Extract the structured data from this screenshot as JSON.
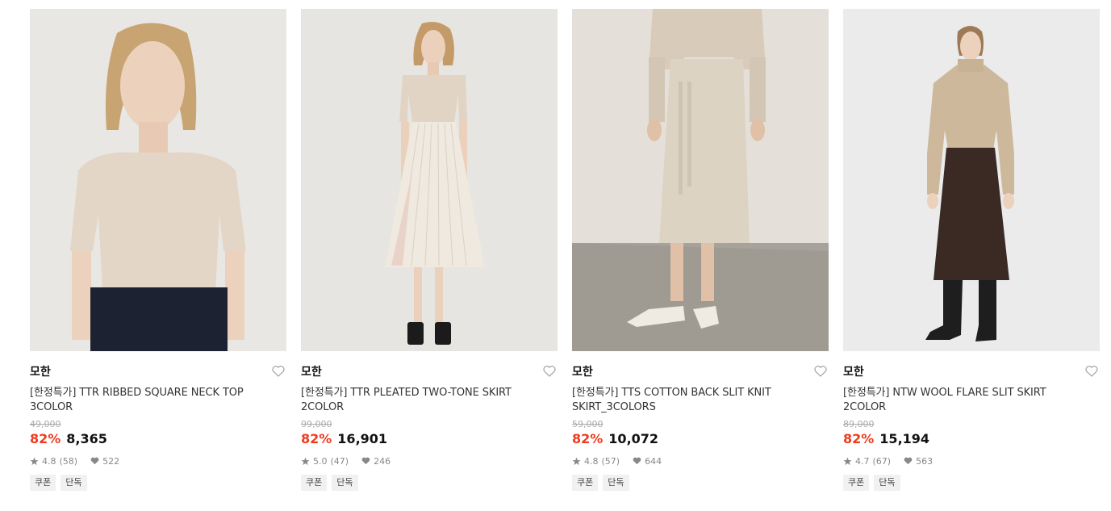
{
  "products": [
    {
      "brand": "모한",
      "title": "[한정특가] TTR RIBBED SQUARE NECK TOP 3COLOR",
      "original_price": "49,000",
      "discount": "82%",
      "price": "8,365",
      "rating": "4.8",
      "reviews": "(58)",
      "likes": "522",
      "badges": [
        "쿠폰",
        "단독"
      ],
      "image_desc": "model in beige square-neck top"
    },
    {
      "brand": "모한",
      "title": "[한정특가] TTR PLEATED TWO-TONE SKIRT 2COLOR",
      "original_price": "99,000",
      "discount": "82%",
      "price": "16,901",
      "rating": "5.0",
      "reviews": "(47)",
      "likes": "246",
      "badges": [
        "쿠폰",
        "단독"
      ],
      "image_desc": "model in cream pleated skirt"
    },
    {
      "brand": "모한",
      "title": "[한정특가] TTS COTTON BACK SLIT KNIT SKIRT_3COLORS",
      "original_price": "59,000",
      "discount": "82%",
      "price": "10,072",
      "rating": "4.8",
      "reviews": "(57)",
      "likes": "644",
      "badges": [
        "쿠폰",
        "단독"
      ],
      "image_desc": "knit skirt with loafers"
    },
    {
      "brand": "모한",
      "title": "[한정특가] NTW WOOL FLARE SLIT SKIRT 2COLOR",
      "original_price": "89,000",
      "discount": "82%",
      "price": "15,194",
      "rating": "4.7",
      "reviews": "(67)",
      "likes": "563",
      "badges": [
        "쿠폰",
        "단독"
      ],
      "image_desc": "model in beige sweater and brown skirt"
    }
  ],
  "icons": {
    "wishlist": "heart-outline-icon",
    "rating": "star-icon",
    "likes": "heart-filled-icon"
  },
  "colors": {
    "discount": "#ef3b1e",
    "price": "#111111",
    "original_price": "#aaaaaa"
  }
}
